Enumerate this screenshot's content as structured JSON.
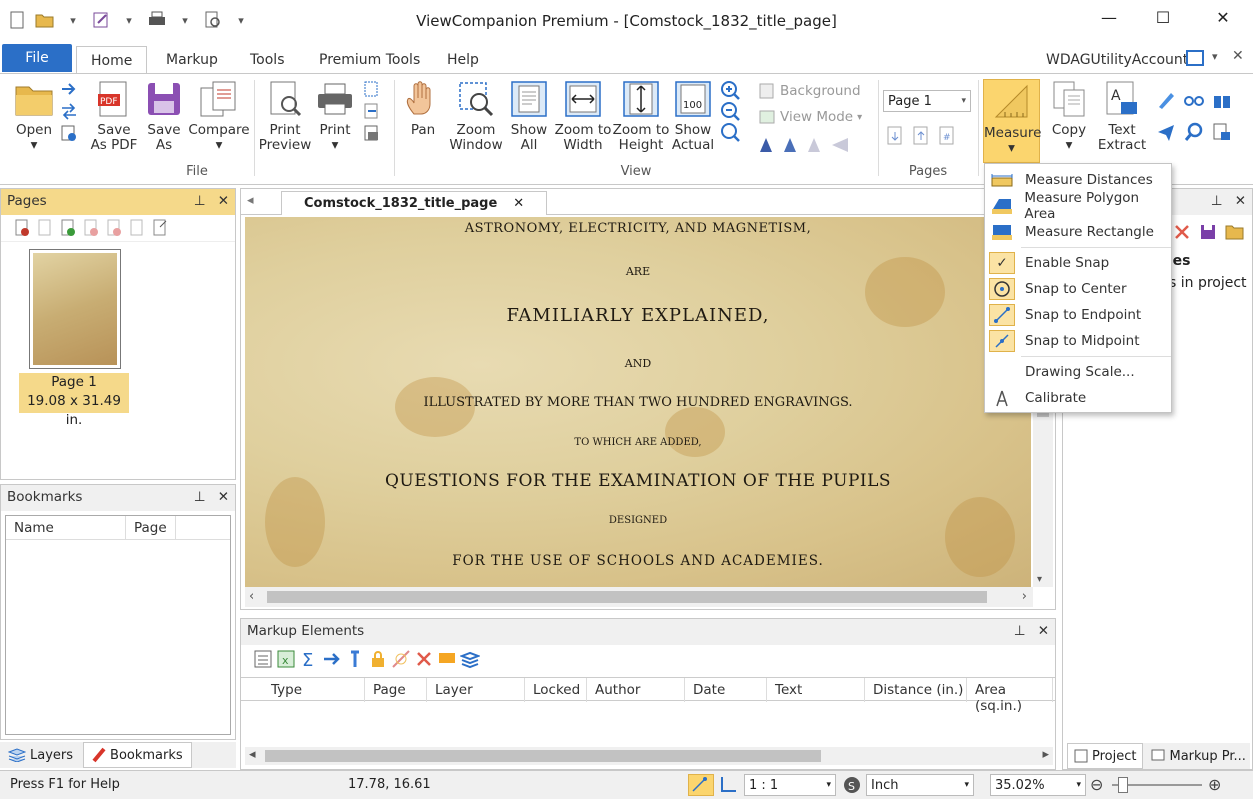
{
  "window": {
    "title": "ViewCompanion Premium - [Comstock_1832_title_page]"
  },
  "tabs": {
    "file": "File",
    "home": "Home",
    "markup": "Markup",
    "tools": "Tools",
    "premium": "Premium Tools",
    "help": "Help",
    "account": "WDAGUtilityAccount"
  },
  "ribbon": {
    "open": "Open",
    "save_pdf_1": "Save",
    "save_pdf_2": "As PDF",
    "save_as_1": "Save",
    "save_as_2": "As",
    "compare": "Compare",
    "print_preview_1": "Print",
    "print_preview_2": "Preview",
    "print": "Print",
    "pan": "Pan",
    "zoom_window_1": "Zoom",
    "zoom_window_2": "Window",
    "show_all_1": "Show",
    "show_all_2": "All",
    "zoom_width_1": "Zoom to",
    "zoom_width_2": "Width",
    "zoom_height_1": "Zoom to",
    "zoom_height_2": "Height",
    "show_actual_1": "Show",
    "show_actual_2": "Actual",
    "background": "Background",
    "view_mode": "View Mode",
    "page_select": "Page 1",
    "measure": "Measure",
    "copy": "Copy",
    "text_extract_1": "Text",
    "text_extract_2": "Extract",
    "groups": {
      "file": "File",
      "view": "View",
      "pages": "Pages"
    }
  },
  "pages_panel": {
    "title": "Pages",
    "thumb_label": "Page 1",
    "thumb_size": "19.08 x 31.49 in."
  },
  "bookmarks_panel": {
    "title": "Bookmarks",
    "col_name": "Name",
    "col_page": "Page"
  },
  "bottom_tabs": {
    "layers": "Layers",
    "bookmarks": "Bookmarks"
  },
  "document": {
    "tab": "Comstock_1832_title_page",
    "lines": [
      "ASTRONOMY, ELECTRICITY, AND MAGNETISM,",
      "ARE",
      "FAMILIARLY EXPLAINED,",
      "AND",
      "ILLUSTRATED BY MORE THAN TWO HUNDRED ENGRAVINGS.",
      "TO WHICH ARE ADDED,",
      "QUESTIONS FOR THE EXAMINATION OF THE PUPILS",
      "DESIGNED",
      "FOR THE USE OF SCHOOLS AND ACADEMIES."
    ]
  },
  "markup_panel": {
    "title": "Markup Elements",
    "columns": [
      "Type",
      "Page",
      "Layer",
      "Locked",
      "Author",
      "Date",
      "Text",
      "Distance (in.)",
      "Area (sq.in.)"
    ]
  },
  "right_panel": {
    "partial_1": "iles",
    "partial_2": "s in project",
    "tab_project": "Project",
    "tab_markup": "Markup Pr..."
  },
  "measure_menu": {
    "items": [
      "Measure Distances",
      "Measure Polygon Area",
      "Measure Rectangle",
      "Enable Snap",
      "Snap to Center",
      "Snap to Endpoint",
      "Snap to Midpoint",
      "Drawing Scale...",
      "Calibrate"
    ]
  },
  "status": {
    "help": "Press F1 for Help",
    "coords": "17.78, 16.61",
    "scale": "1 : 1",
    "unit": "Inch",
    "zoom": "35.02%"
  },
  "colors": {
    "accent": "#2b6fc7",
    "highlight": "#f5d98a",
    "menu_check": "#fbe3a4"
  }
}
